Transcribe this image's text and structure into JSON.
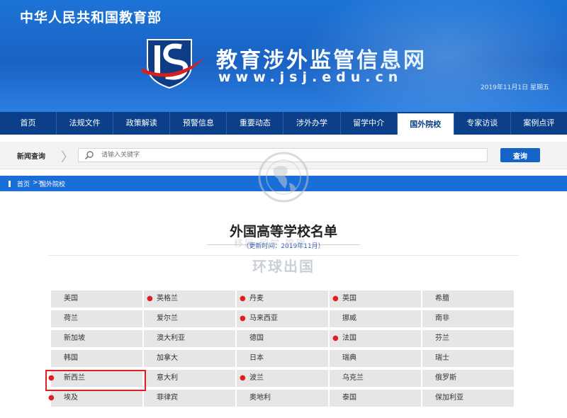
{
  "header": {
    "ministry": "中华人民共和国教育部",
    "site_title": "教育涉外监管信息网",
    "site_url": "www.jsj.edu.cn",
    "date": "2019年11月1日 星期五",
    "brand_color": "#1a62c4"
  },
  "nav": {
    "items": [
      "首页",
      "法规文件",
      "政策解读",
      "预警信息",
      "重要动态",
      "涉外办学",
      "留学中介",
      "国外院校",
      "专家访谈",
      "案例点评"
    ],
    "active_index": 7
  },
  "search": {
    "label": "新闻查询",
    "placeholder": "请输入关键字",
    "button": "查询"
  },
  "breadcrumb": {
    "home": "首页",
    "separator": ">>",
    "current": "国外院校"
  },
  "main": {
    "title": "外国高等学校名单",
    "subtitle": "（更新时间：2019年11月）"
  },
  "watermark": {
    "small": "移民  留学  管理",
    "large": "环球出国"
  },
  "countries": [
    {
      "name": "美国",
      "marked": false
    },
    {
      "name": "英格兰",
      "marked": true
    },
    {
      "name": "丹麦",
      "marked": true
    },
    {
      "name": "英国",
      "marked": true
    },
    {
      "name": "希腊",
      "marked": false
    },
    {
      "name": "荷兰",
      "marked": false
    },
    {
      "name": "爱尔兰",
      "marked": false
    },
    {
      "name": "马来西亚",
      "marked": true
    },
    {
      "name": "挪威",
      "marked": false
    },
    {
      "name": "南非",
      "marked": false
    },
    {
      "name": "新加坡",
      "marked": false
    },
    {
      "name": "澳大利亚",
      "marked": false
    },
    {
      "name": "德国",
      "marked": false
    },
    {
      "name": "法国",
      "marked": true
    },
    {
      "name": "芬兰",
      "marked": false
    },
    {
      "name": "韩国",
      "marked": false
    },
    {
      "name": "加拿大",
      "marked": false
    },
    {
      "name": "日本",
      "marked": false
    },
    {
      "name": "瑞典",
      "marked": false
    },
    {
      "name": "瑞士",
      "marked": false
    },
    {
      "name": "新西兰",
      "marked": true
    },
    {
      "name": "意大利",
      "marked": false
    },
    {
      "name": "波兰",
      "marked": true
    },
    {
      "name": "乌克兰",
      "marked": false
    },
    {
      "name": "俄罗斯",
      "marked": false
    },
    {
      "name": "埃及",
      "marked": true
    },
    {
      "name": "菲律宾",
      "marked": false
    },
    {
      "name": "奥地利",
      "marked": false
    },
    {
      "name": "泰国",
      "marked": false
    },
    {
      "name": "保加利亚",
      "marked": false
    }
  ],
  "highlighted_country": "新西兰"
}
